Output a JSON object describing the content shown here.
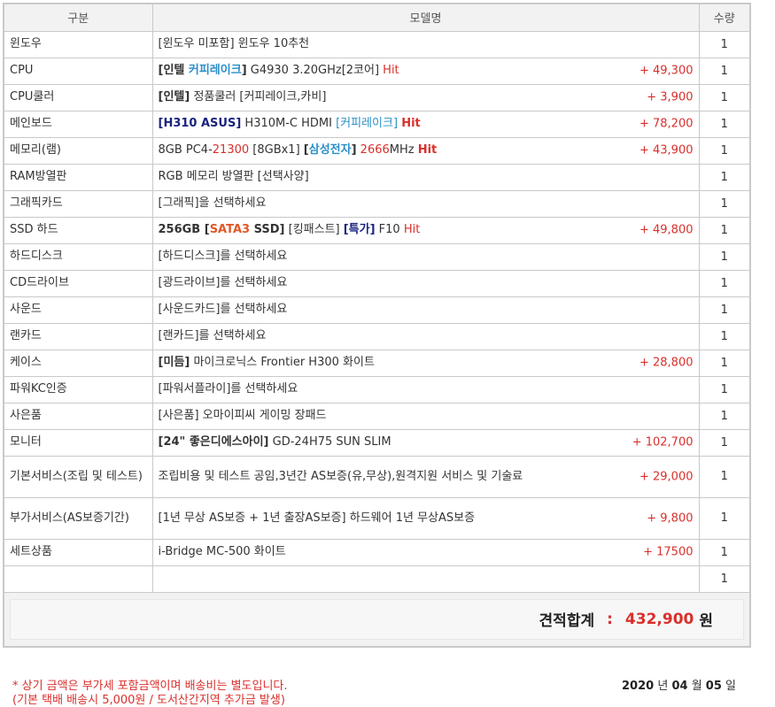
{
  "headers": {
    "category": "구분",
    "model": "모델명",
    "qty": "수량"
  },
  "rows": [
    {
      "category": "윈도우",
      "parts": [
        {
          "t": "[윈도우 미포함] 윈도우 10추천",
          "s": ""
        }
      ],
      "price": "",
      "qty": "1"
    },
    {
      "category": "CPU",
      "parts": [
        {
          "t": "[인텔 ",
          "s": "b"
        },
        {
          "t": "커피레이크",
          "s": "b blue"
        },
        {
          "t": "]",
          "s": "b"
        },
        {
          "t": " G4930 3.20GHz[2코어] ",
          "s": ""
        },
        {
          "t": "Hit",
          "s": "hit"
        }
      ],
      "price": "+ 49,300",
      "qty": "1"
    },
    {
      "category": "CPU쿨러",
      "parts": [
        {
          "t": "[인텔]",
          "s": "b"
        },
        {
          "t": " 정품쿨러 [커피레이크,카비]",
          "s": ""
        }
      ],
      "price": "+ 3,900",
      "qty": "1"
    },
    {
      "category": "메인보드",
      "parts": [
        {
          "t": "[H310 ASUS]",
          "s": "navy"
        },
        {
          "t": " H310M-C HDMI ",
          "s": ""
        },
        {
          "t": "[커피레이크]",
          "s": "blue"
        },
        {
          "t": " ",
          "s": ""
        },
        {
          "t": "Hit",
          "s": "b red"
        }
      ],
      "price": "+ 78,200",
      "qty": "1"
    },
    {
      "category": "메모리(램)",
      "parts": [
        {
          "t": "8GB PC4-",
          "s": ""
        },
        {
          "t": "21300",
          "s": "red"
        },
        {
          "t": " [8GBx1] ",
          "s": ""
        },
        {
          "t": "[",
          "s": "b"
        },
        {
          "t": "삼성전자",
          "s": "b blue"
        },
        {
          "t": "]",
          "s": "b"
        },
        {
          "t": " ",
          "s": ""
        },
        {
          "t": "2666",
          "s": "red"
        },
        {
          "t": "MHz ",
          "s": ""
        },
        {
          "t": "Hit",
          "s": "b red"
        }
      ],
      "price": "+ 43,900",
      "qty": "1"
    },
    {
      "category": "RAM방열판",
      "parts": [
        {
          "t": "RGB 메모리 방열판 [선택사양]",
          "s": ""
        }
      ],
      "price": "",
      "qty": "1"
    },
    {
      "category": "그래픽카드",
      "parts": [
        {
          "t": "[그래픽]을 선택하세요",
          "s": ""
        }
      ],
      "price": "",
      "qty": "1"
    },
    {
      "category": "SSD 하드",
      "parts": [
        {
          "t": "256GB [",
          "s": "b"
        },
        {
          "t": "SATA3",
          "s": "orange"
        },
        {
          "t": " SSD]",
          "s": "b"
        },
        {
          "t": " [킹패스트] ",
          "s": ""
        },
        {
          "t": "[특가]",
          "s": "navy"
        },
        {
          "t": " F10 ",
          "s": ""
        },
        {
          "t": "Hit",
          "s": "hit"
        }
      ],
      "price": "+ 49,800",
      "qty": "1"
    },
    {
      "category": "하드디스크",
      "parts": [
        {
          "t": "[하드디스크]를 선택하세요",
          "s": ""
        }
      ],
      "price": "",
      "qty": "1"
    },
    {
      "category": "CD드라이브",
      "parts": [
        {
          "t": "[광드라이브]를 선택하세요",
          "s": ""
        }
      ],
      "price": "",
      "qty": "1"
    },
    {
      "category": "사운드",
      "parts": [
        {
          "t": "[사운드카드]를 선택하세요",
          "s": ""
        }
      ],
      "price": "",
      "qty": "1"
    },
    {
      "category": "랜카드",
      "parts": [
        {
          "t": "[랜카드]를 선택하세요",
          "s": ""
        }
      ],
      "price": "",
      "qty": "1"
    },
    {
      "category": "케이스",
      "parts": [
        {
          "t": "[미듬]",
          "s": "b"
        },
        {
          "t": " 마이크로닉스 Frontier H300 화이트",
          "s": ""
        }
      ],
      "price": "+ 28,800",
      "qty": "1"
    },
    {
      "category": "파워KC인증",
      "parts": [
        {
          "t": "[파워서플라이]를 선택하세요",
          "s": ""
        }
      ],
      "price": "",
      "qty": "1"
    },
    {
      "category": "사은품",
      "parts": [
        {
          "t": "[사은품] 오마이피씨 게이밍 장패드",
          "s": ""
        }
      ],
      "price": "",
      "qty": "1"
    },
    {
      "category": "모니터",
      "parts": [
        {
          "t": "[24\" 좋은디에스아이]",
          "s": "b"
        },
        {
          "t": " GD-24H75 SUN SLIM",
          "s": ""
        }
      ],
      "price": "+ 102,700",
      "qty": "1"
    },
    {
      "category": "기본서비스(조립 및 테스트)",
      "tall": true,
      "parts": [
        {
          "t": "조립비용 및 테스트 공임,3년간 AS보증(유,무상),원격지원 서비스 및 기술료",
          "s": ""
        }
      ],
      "price": "+ 29,000",
      "qty": "1"
    },
    {
      "category": "부가서비스(AS보증기간)",
      "tall": true,
      "parts": [
        {
          "t": "[1년 무상 AS보증 + 1년 출장AS보증] 하드웨어 1년 무상AS보증",
          "s": ""
        }
      ],
      "price": "+ 9,800",
      "qty": "1"
    },
    {
      "category": "세트상품",
      "parts": [
        {
          "t": "i-Bridge MC-500 화이트",
          "s": ""
        }
      ],
      "price": "+ 17500",
      "qty": "1"
    },
    {
      "category": "",
      "parts": [],
      "price": "",
      "qty": "1"
    }
  ],
  "total": {
    "label": "견적합계",
    "colon": ":",
    "amount": "432,900",
    "unit": "원"
  },
  "footer": {
    "note1": "* 상기 금액은 부가세 포함금액이며 배송비는 별도입니다.",
    "note2": "(기본 택배 배송시 5,000원 / 도서산간지역 추가금 발생)",
    "date": {
      "year": "2020",
      "year_unit": "년",
      "month": "04",
      "month_unit": "월",
      "day": "05",
      "day_unit": "일"
    }
  },
  "colors": {
    "price": "#d9302c",
    "blue_tag": "#2b8fc9",
    "navy_tag": "#1a237e",
    "border": "#c9c9c9",
    "header_bg": "#f2f2f2"
  }
}
